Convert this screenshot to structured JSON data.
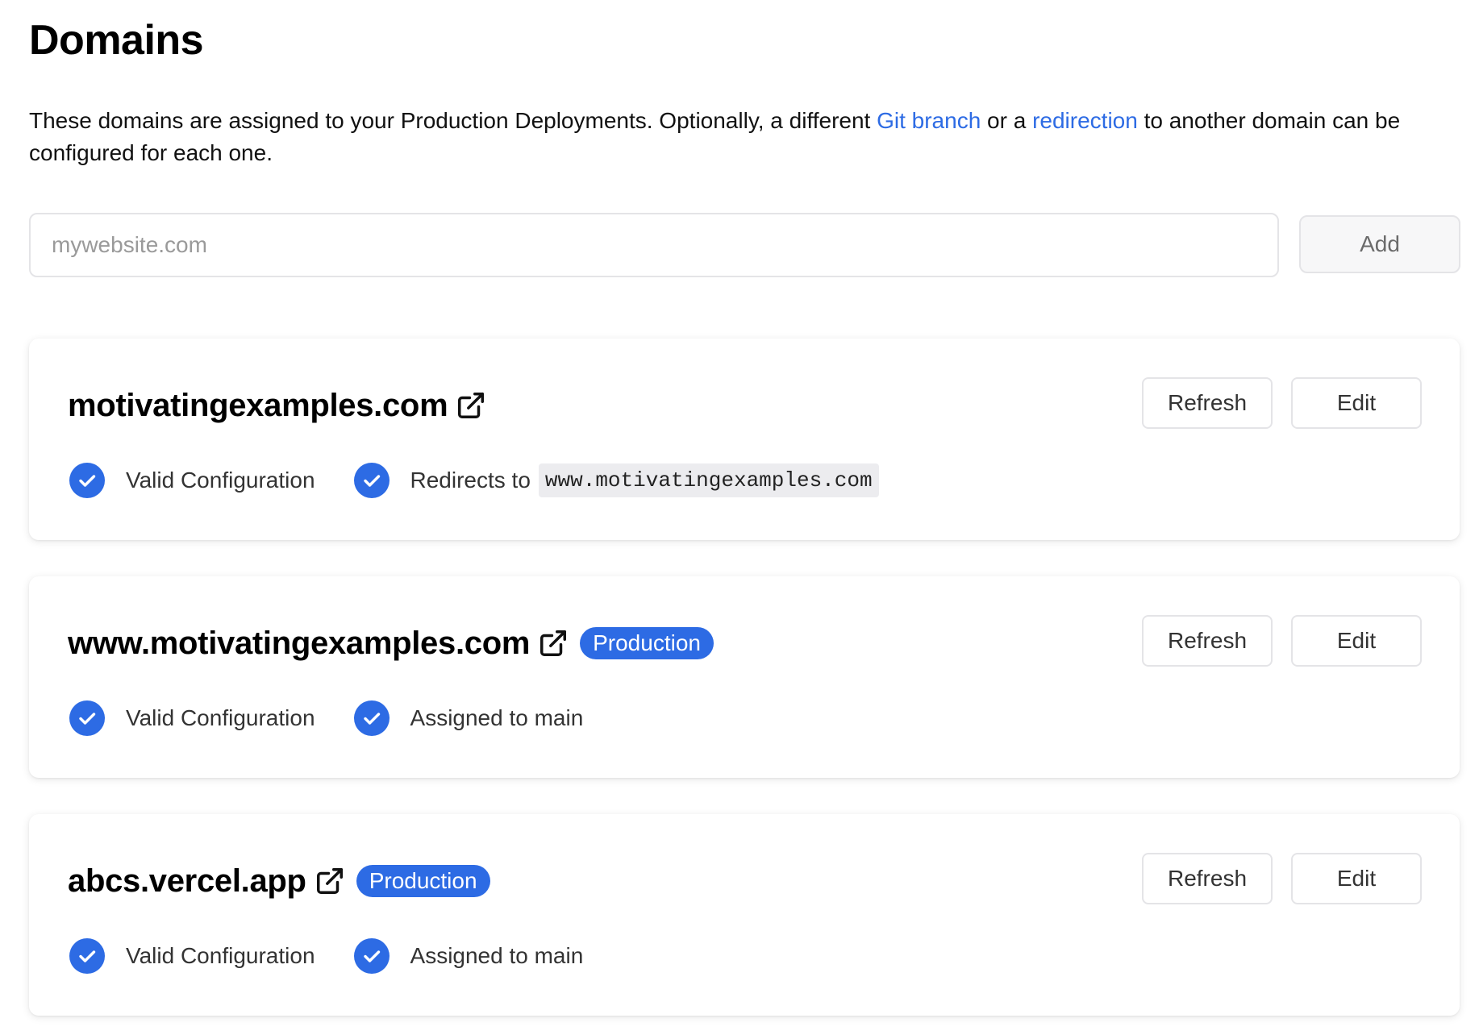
{
  "page": {
    "title": "Domains",
    "intro": {
      "before": "These domains are assigned to your Production Deployments. Optionally, a different ",
      "link1": "Git branch",
      "middle": " or a ",
      "link2": "redirection",
      "after": " to another domain can be configured for each one."
    }
  },
  "add_form": {
    "placeholder": "mywebsite.com",
    "value": "",
    "add_label": "Add"
  },
  "colors": {
    "accent": "#2d6be4",
    "badge_bg": "#2d6be4",
    "border": "#e4e4e7"
  },
  "icons": {
    "external": "external-link-icon",
    "check": "check-circle-icon"
  },
  "domains": [
    {
      "name": "motivatingexamples.com",
      "badge": "",
      "refresh_label": "Refresh",
      "edit_label": "Edit",
      "status1": "Valid Configuration",
      "status2": "Redirects to",
      "status2_code": "www.motivatingexamples.com"
    },
    {
      "name": "www.motivatingexamples.com",
      "badge": "Production",
      "refresh_label": "Refresh",
      "edit_label": "Edit",
      "status1": "Valid Configuration",
      "status2": "Assigned to main",
      "status2_code": ""
    },
    {
      "name": "abcs.vercel.app",
      "badge": "Production",
      "refresh_label": "Refresh",
      "edit_label": "Edit",
      "status1": "Valid Configuration",
      "status2": "Assigned to main",
      "status2_code": ""
    }
  ]
}
